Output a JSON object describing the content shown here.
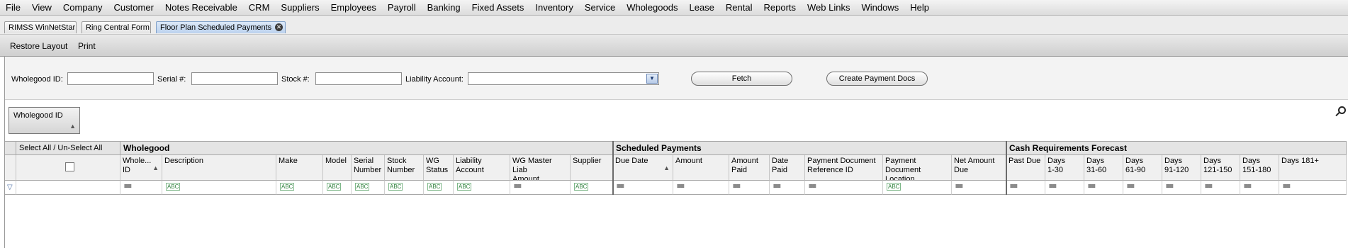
{
  "menu": [
    "File",
    "View",
    "Company",
    "Customer",
    "Notes Receivable",
    "CRM",
    "Suppliers",
    "Employees",
    "Payroll",
    "Banking",
    "Fixed Assets",
    "Inventory",
    "Service",
    "Wholegoods",
    "Lease",
    "Rental",
    "Reports",
    "Web Links",
    "Windows",
    "Help"
  ],
  "tabs": [
    "RIMSS WinNetStar",
    "Ring Central Form",
    "Floor Plan Scheduled Payments"
  ],
  "tab_close_glyph": "✕",
  "toolbar": {
    "restore_layout": "Restore Layout",
    "print": "Print"
  },
  "filters": {
    "wholegood_id_label": "Wholegood ID:",
    "wholegood_id_value": "",
    "serial_label": "Serial #:",
    "serial_value": "",
    "stock_label": "Stock #:",
    "stock_value": "",
    "liability_account_label": "Liability Account:",
    "liability_account_value": "",
    "fetch": "Fetch",
    "create_payment_docs": "Create Payment Docs"
  },
  "group_by": {
    "label": "Wholegood ID"
  },
  "bands": {
    "select_all": "Select All / Un-Select All",
    "wholegood": "Wholegood",
    "scheduled_payments": "Scheduled Payments",
    "cash_requirements": "Cash Requirements Forecast"
  },
  "columns": [
    {
      "label": "Whole...\nID",
      "filter": "eq",
      "sorted": true
    },
    {
      "label": "Description",
      "filter": "abc"
    },
    {
      "label": "Make",
      "filter": "abc"
    },
    {
      "label": "Model",
      "filter": "abc"
    },
    {
      "label": "Serial\nNumber",
      "filter": "abc"
    },
    {
      "label": "Stock\nNumber",
      "filter": "abc"
    },
    {
      "label": "WG\nStatus",
      "filter": "abc"
    },
    {
      "label": "Liability\nAccount",
      "filter": "abc"
    },
    {
      "label": "WG Master Liab\nAmount",
      "filter": "eq"
    },
    {
      "label": "Supplier",
      "filter": "abc"
    },
    {
      "label": "Due Date",
      "filter": "eq",
      "sorted": true
    },
    {
      "label": "Amount",
      "filter": "eq"
    },
    {
      "label": "Amount\nPaid",
      "filter": "eq"
    },
    {
      "label": "Date\nPaid",
      "filter": "eq"
    },
    {
      "label": "Payment Document\nReference ID",
      "filter": "eq"
    },
    {
      "label": "Payment\nDocument Location",
      "filter": "abc"
    },
    {
      "label": "Net Amount\nDue",
      "filter": "eq"
    },
    {
      "label": "Past Due",
      "filter": "eq"
    },
    {
      "label": "Days\n1-30",
      "filter": "eq"
    },
    {
      "label": "Days\n31-60",
      "filter": "eq"
    },
    {
      "label": "Days\n61-90",
      "filter": "eq"
    },
    {
      "label": "Days\n91-120",
      "filter": "eq"
    },
    {
      "label": "Days\n121-150",
      "filter": "eq"
    },
    {
      "label": "Days\n151-180",
      "filter": "eq"
    },
    {
      "label": "Days 181+",
      "filter": "eq"
    }
  ],
  "filter_glyphs": {
    "eq": "==",
    "abc": "ABC"
  },
  "colors": {
    "accent": "#7f9fc8",
    "header_bg": "#f0f0f0",
    "band_bg": "#e4e4e4"
  }
}
